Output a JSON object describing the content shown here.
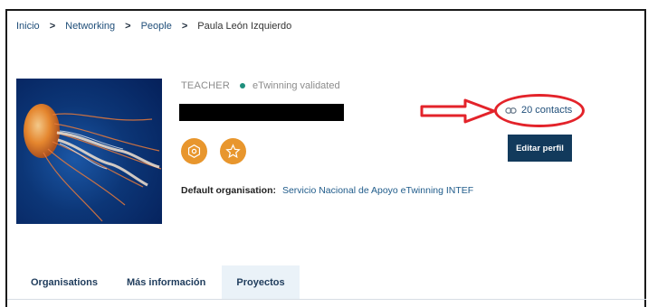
{
  "breadcrumb": {
    "items": [
      "Inicio",
      "Networking",
      "People"
    ],
    "current": "Paula León Izquierdo"
  },
  "profile": {
    "role": "TEACHER",
    "validation_status": "eTwinning validated",
    "validation_color": "#1f8f7d",
    "badges": [
      "hexagon-badge-icon",
      "star-badge-icon"
    ],
    "badge_color": "#e8962d",
    "default_org_label": "Default organisation:",
    "default_org_value": "Servicio Nacional de Apoyo eTwinning INTEF"
  },
  "contacts": {
    "label": "20 contacts",
    "icon": "link-icon"
  },
  "actions": {
    "edit_label": "Editar perfil"
  },
  "annotation": {
    "color": "#e3232a"
  },
  "tabs": [
    {
      "label": "Organisations",
      "active": false
    },
    {
      "label": "Más información",
      "active": false
    },
    {
      "label": "Proyectos",
      "active": true
    }
  ]
}
